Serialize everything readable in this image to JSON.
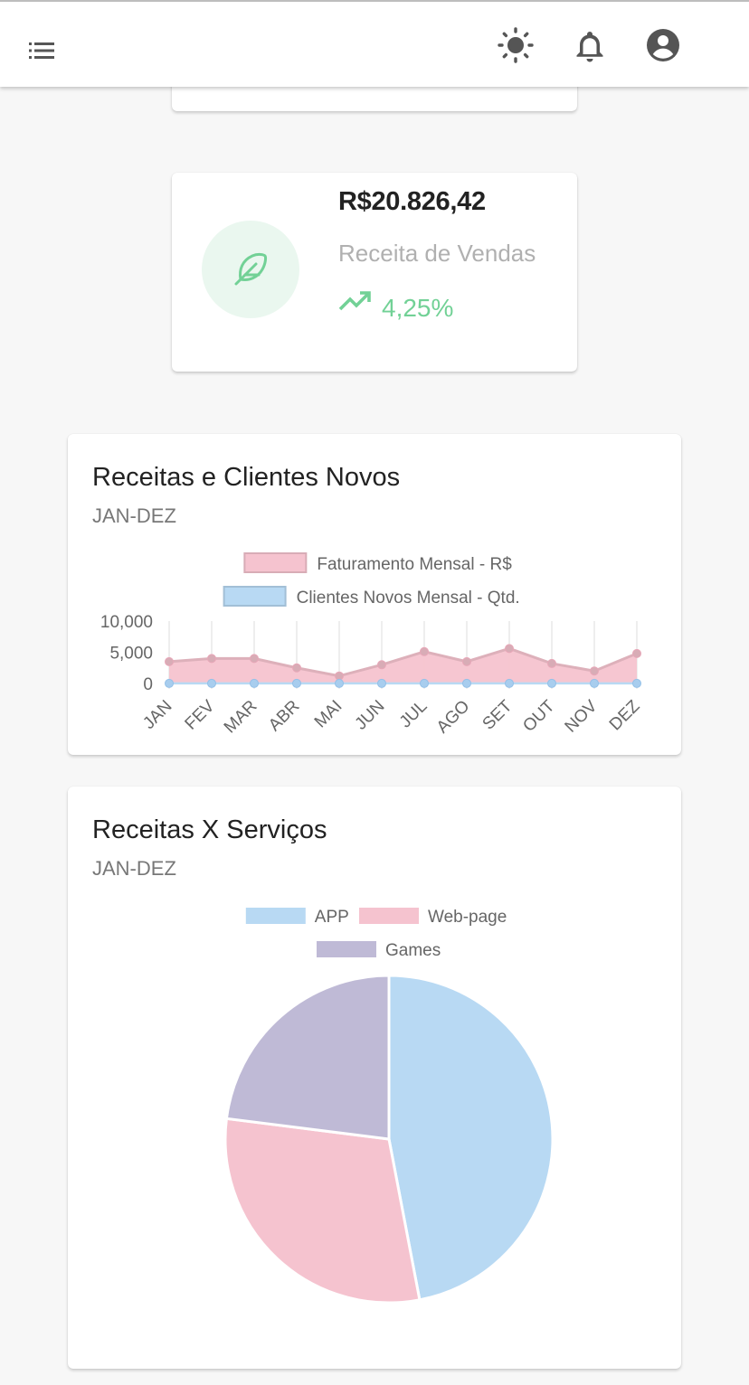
{
  "header": {
    "menu_icon": "menu-list-icon",
    "theme_icon": "sun-icon",
    "notifications_icon": "bell-icon",
    "account_icon": "account-circle-icon"
  },
  "stat_card": {
    "value": "R$20.826,42",
    "label": "Receita de Vendas",
    "change": "4,25%",
    "icon": "feather-icon",
    "trend_icon": "trending-up-icon",
    "accent_color": "#72d196"
  },
  "line_card": {
    "title": "Receitas e Clientes Novos",
    "subtitle": "JAN-DEZ"
  },
  "pie_card": {
    "title": "Receitas X Serviços",
    "subtitle": "JAN-DEZ"
  },
  "chart_data": [
    {
      "type": "area",
      "categories": [
        "JAN",
        "FEV",
        "MAR",
        "ABR",
        "MAI",
        "JUN",
        "JUL",
        "AGO",
        "SET",
        "OUT",
        "NOV",
        "DEZ"
      ],
      "series": [
        {
          "name": "Faturamento Mensal - R$",
          "values": [
            3500,
            4000,
            4000,
            2500,
            1200,
            3000,
            5100,
            3500,
            5600,
            3200,
            2000,
            4800
          ],
          "color": "#f5c3cf"
        },
        {
          "name": "Clientes Novos Mensal - Qtd.",
          "values": [
            10,
            10,
            10,
            10,
            10,
            10,
            10,
            10,
            10,
            10,
            10,
            10
          ],
          "color": "#b8d9f3"
        }
      ],
      "yticks": [
        "10,000",
        "5,000",
        "0"
      ],
      "ylim": [
        0,
        10000
      ],
      "legend": "top"
    },
    {
      "type": "pie",
      "categories": [
        "APP",
        "Web-page",
        "Games"
      ],
      "values": [
        47,
        30,
        23
      ],
      "colors": [
        "#b8d9f3",
        "#f5c3cf",
        "#bfbad6"
      ],
      "legend": "top"
    }
  ]
}
